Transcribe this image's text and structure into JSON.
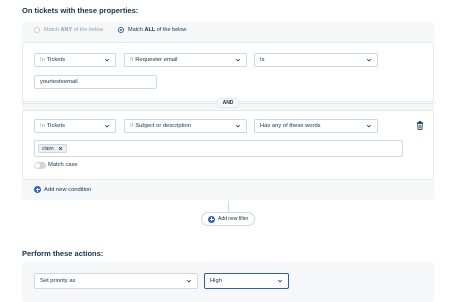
{
  "conditions_section": {
    "title": "On tickets with these properties:",
    "match_any": {
      "prefix": "Match ",
      "bold": "ANY",
      "suffix": " of the below"
    },
    "match_all": {
      "prefix": "Match ",
      "bold": "ALL",
      "suffix": " of the below"
    },
    "selected_match": "ALL"
  },
  "condition1": {
    "scope_prefix": "In",
    "scope": "Tickets",
    "field_prefix": "If",
    "field": "Requester email",
    "operator": "Is",
    "value": "yourtesteemail"
  },
  "and_label": "AND",
  "condition2": {
    "scope_prefix": "In",
    "scope": "Tickets",
    "field_prefix": "If",
    "field": "Subject or description",
    "operator": "Has any of these words",
    "tag": "claim",
    "match_case_label": "Match case"
  },
  "add_condition_label": "Add new condition",
  "add_filter_label": "Add new filter",
  "actions_section": {
    "title": "Perform these actions:",
    "action": "Set priority as",
    "value": "High"
  },
  "colors": {
    "accent": "#2c5cc5",
    "text": "#12344d",
    "panel": "#f5f7f9",
    "border": "#cfd7df"
  }
}
